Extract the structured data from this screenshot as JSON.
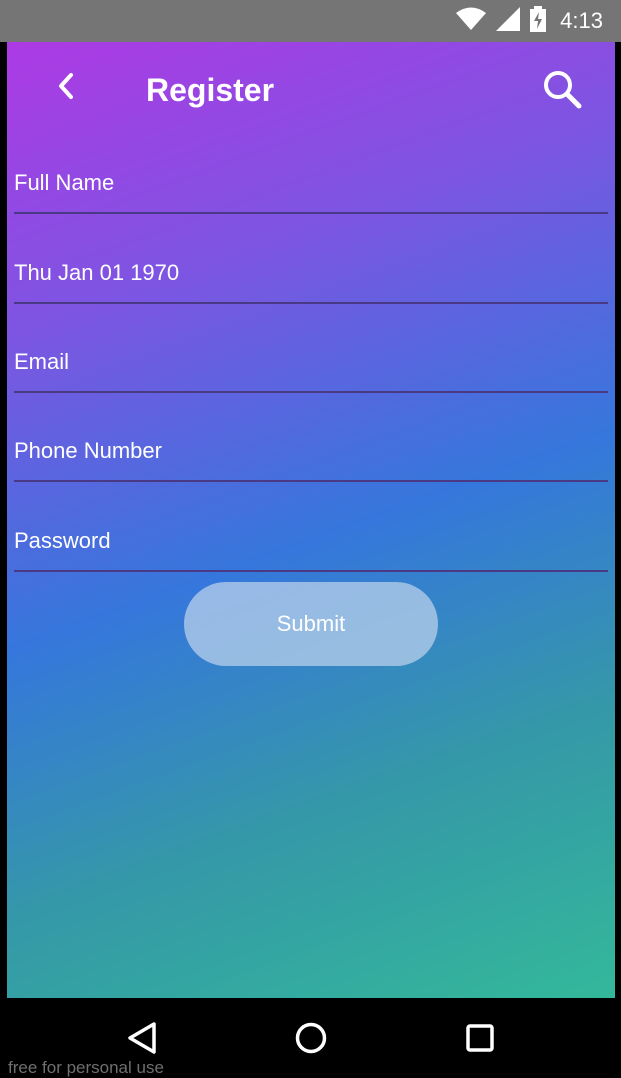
{
  "status_bar": {
    "time": "4:13"
  },
  "toolbar": {
    "title": "Register"
  },
  "form": {
    "full_name_placeholder": "Full Name",
    "dob_value": "Thu Jan 01 1970",
    "email_placeholder": "Email",
    "phone_placeholder": "Phone Number",
    "password_placeholder": "Password",
    "submit_label": "Submit"
  },
  "watermark": "free for personal use",
  "icons": {
    "back": "chevron-left-icon",
    "search": "search-icon",
    "nav_back": "triangle-back-icon",
    "nav_home": "circle-home-icon",
    "nav_recents": "square-recents-icon"
  },
  "colors": {
    "gradient_top": "#ad3ae4",
    "gradient_mid": "#3577dc",
    "gradient_bottom": "#33b89a",
    "field_underline": "#4a3a86"
  }
}
